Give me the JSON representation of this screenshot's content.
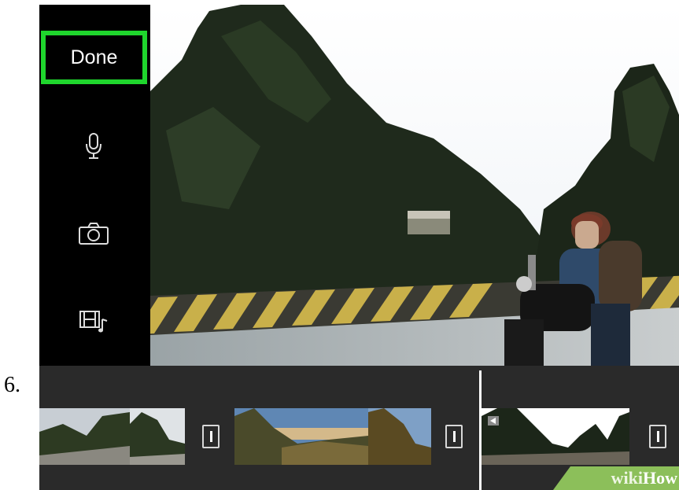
{
  "step": {
    "number": "6."
  },
  "sidebar": {
    "done_label": "Done",
    "icons": [
      "microphone-icon",
      "camera-icon",
      "film-music-icon"
    ]
  },
  "timeline": {
    "clips": [
      {
        "name": "mountain-road-clip"
      },
      {
        "name": "valley-overlook-clip"
      },
      {
        "name": "cliff-motorcycle-clip"
      }
    ],
    "transition_icon": "transition-icon"
  },
  "watermark": {
    "prefix": "wiki",
    "suffix": "How"
  },
  "colors": {
    "highlight": "#1fd62d",
    "sidebar_bg": "#000000",
    "timeline_bg": "#2a2a2a",
    "watermark_bg": "#8cbf5a"
  }
}
